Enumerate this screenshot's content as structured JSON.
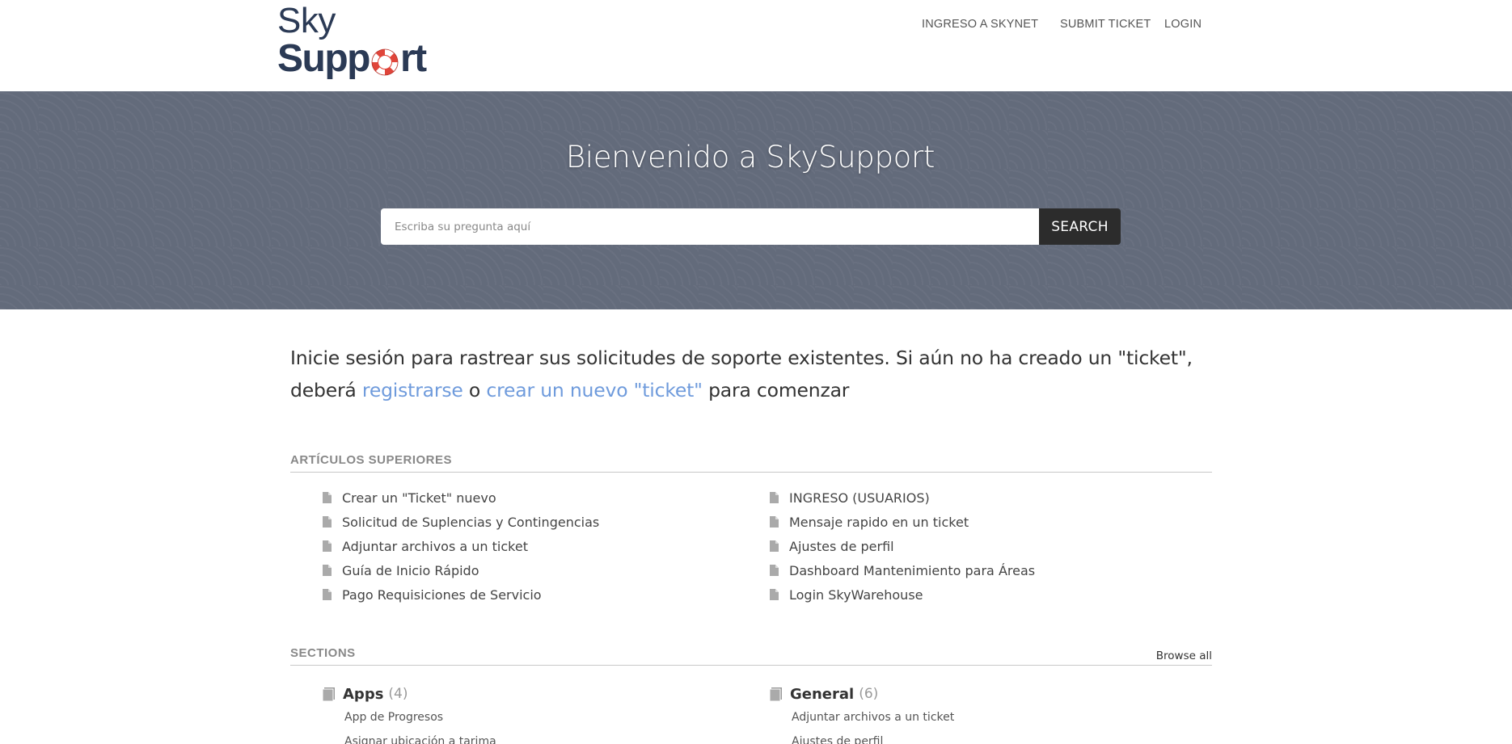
{
  "header": {
    "logo_top": "Sky",
    "logo_bottom_start": "Supp",
    "logo_bottom_end": "rt",
    "nav": [
      "INGRESO A SKYNET",
      "SUBMIT TICKET",
      "LOGIN"
    ]
  },
  "hero": {
    "title": "Bienvenido a SkySupport",
    "search_placeholder": "Escriba su pregunta aquí",
    "search_button": "SEARCH"
  },
  "intro": {
    "line_start": "Inicie sesión para rastrear sus solicitudes de soporte existentes. Si aún no ha creado un \"ticket\", deberá ",
    "link_register": "registrarse",
    "middle": " o ",
    "link_new_ticket": "crear un nuevo \"ticket\"",
    "end": " para comenzar"
  },
  "top_articles": {
    "title": "ARTÍCULOS SUPERIORES",
    "left": [
      "Crear un \"Ticket\" nuevo",
      "Solicitud de Suplencias y Contingencias",
      "Adjuntar archivos a un ticket",
      "Guía de Inicio Rápido",
      "Pago Requisiciones de Servicio"
    ],
    "right": [
      "INGRESO (USUARIOS)",
      "Mensaje rapido en un ticket",
      "Ajustes de perfil",
      "Dashboard Mantenimiento para Áreas",
      "Login SkyWarehouse"
    ]
  },
  "sections": {
    "title": "SECTIONS",
    "browse_all": "Browse all",
    "items": [
      {
        "name": "Apps",
        "count": "(4)",
        "articles": [
          "App de Progresos",
          "Asignar ubicación a tarima"
        ]
      },
      {
        "name": "General",
        "count": "(6)",
        "articles": [
          "Adjuntar archivos a un ticket",
          "Ajustes de perfil"
        ]
      }
    ]
  },
  "colors": {
    "brand_navy": "#2b3a55",
    "hero_bg": "#636b7b",
    "link_blue": "#6f9bdc",
    "button_dark": "#2c2c2c",
    "lifering_red": "#e0453a"
  }
}
